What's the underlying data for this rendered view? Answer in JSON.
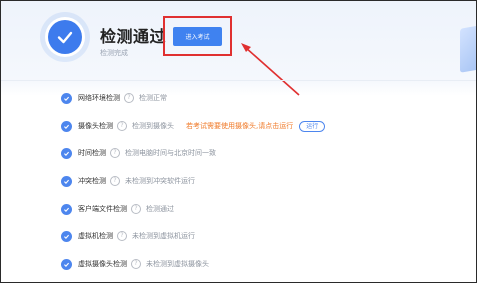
{
  "header": {
    "title": "检测通过",
    "subtitle": "检测完成",
    "enter_button": "进入考试"
  },
  "checks": [
    {
      "name": "网络环境检测",
      "status": "检测正常"
    },
    {
      "name": "摄像头检测",
      "status": "检测到摄像头",
      "warning": "若考试需要使用摄像头,请点击运行",
      "action": "运行"
    },
    {
      "name": "时间检测",
      "status": "检测电脑时间与北京时间一致"
    },
    {
      "name": "冲突检测",
      "status": "未检测到冲突软件运行"
    },
    {
      "name": "客户端文件检测",
      "status": "检测通过"
    },
    {
      "name": "虚拟机检测",
      "status": "未检测到虚拟机运行"
    },
    {
      "name": "虚拟摄像头检测",
      "status": "未检测到虚拟摄像头"
    }
  ],
  "colors": {
    "accent": "#3f82f0",
    "highlight_border": "#e03030",
    "warning": "#f07a28"
  },
  "icons": [
    "check-circle-icon",
    "help-icon",
    "arrow-annotation-icon"
  ]
}
